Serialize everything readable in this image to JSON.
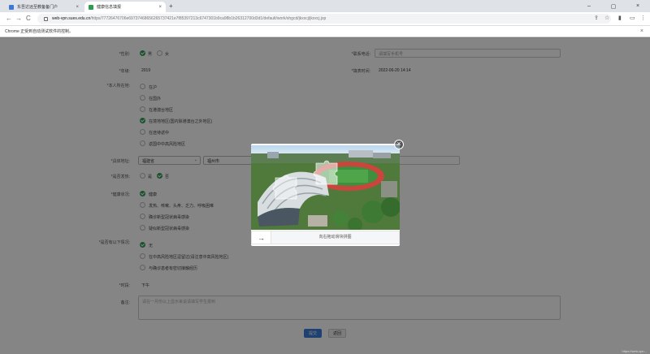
{
  "browser": {
    "tabs": [
      {
        "title": "东吾达远至教备备门户"
      },
      {
        "title": "健康信息填报"
      }
    ],
    "new_tab": "+",
    "url_host": "web-vpn.sues.edu.cn",
    "url_path": "/https/77726476706e69737468656265737421e7f85397213c6747301b9ca98b1b26312700d3d1/default/work/shgcd/jkxxcj/jkxxcj.jsp",
    "infobar_text": "Chrome 正受到自动测试软件的控制。",
    "back_icon": "←",
    "forward_icon": "→",
    "reload_icon": "C"
  },
  "form": {
    "gender_label": "*性别:",
    "gender_options": [
      "男",
      "女"
    ],
    "phone_label": "*联系电话:",
    "phone_placeholder": "请填写手机号",
    "grade_label": "*年级:",
    "grade_value": "2019",
    "fill_time_label": "*填表时间:",
    "fill_time_value": "2022-06-20 14:14",
    "location_label": "*本人所在地:",
    "location_options": [
      "在沪",
      "在国外",
      "在港澳台地区",
      "在境地地区(国内除港澳台之外地区)",
      "在途待返中",
      "返国中中高风险地区"
    ],
    "address_label": "*具体地址:",
    "province_value": "福建省",
    "city_value": "福州市",
    "fever_label": "*是否发热:",
    "fever_options": [
      "是",
      "否"
    ],
    "health_label": "*健康状况:",
    "health_options": [
      "健康",
      "发热、咳嗽、头疼、乏力、呼吸困难",
      "确诊新型冠状病毒感染",
      "疑似新型冠状病毒感染"
    ],
    "situation_label": "*是否有以下情况:",
    "situation_options": [
      "无",
      "在中高风险地区逗留过(请注意中高风险地区)",
      "与确诊患者有密切接触经历"
    ],
    "period_label": "*时段:",
    "period_value": "下午",
    "remark_label": "备注:",
    "remark_placeholder": "请在一月份以上显示来说请填写学生报到",
    "submit_label": "提交",
    "return_label": "返回"
  },
  "captcha": {
    "slider_hint": "向右拖动滑块拼图",
    "handle_icon": "→",
    "close_icon": "×"
  },
  "status_bottom": "https://web-vpn..."
}
